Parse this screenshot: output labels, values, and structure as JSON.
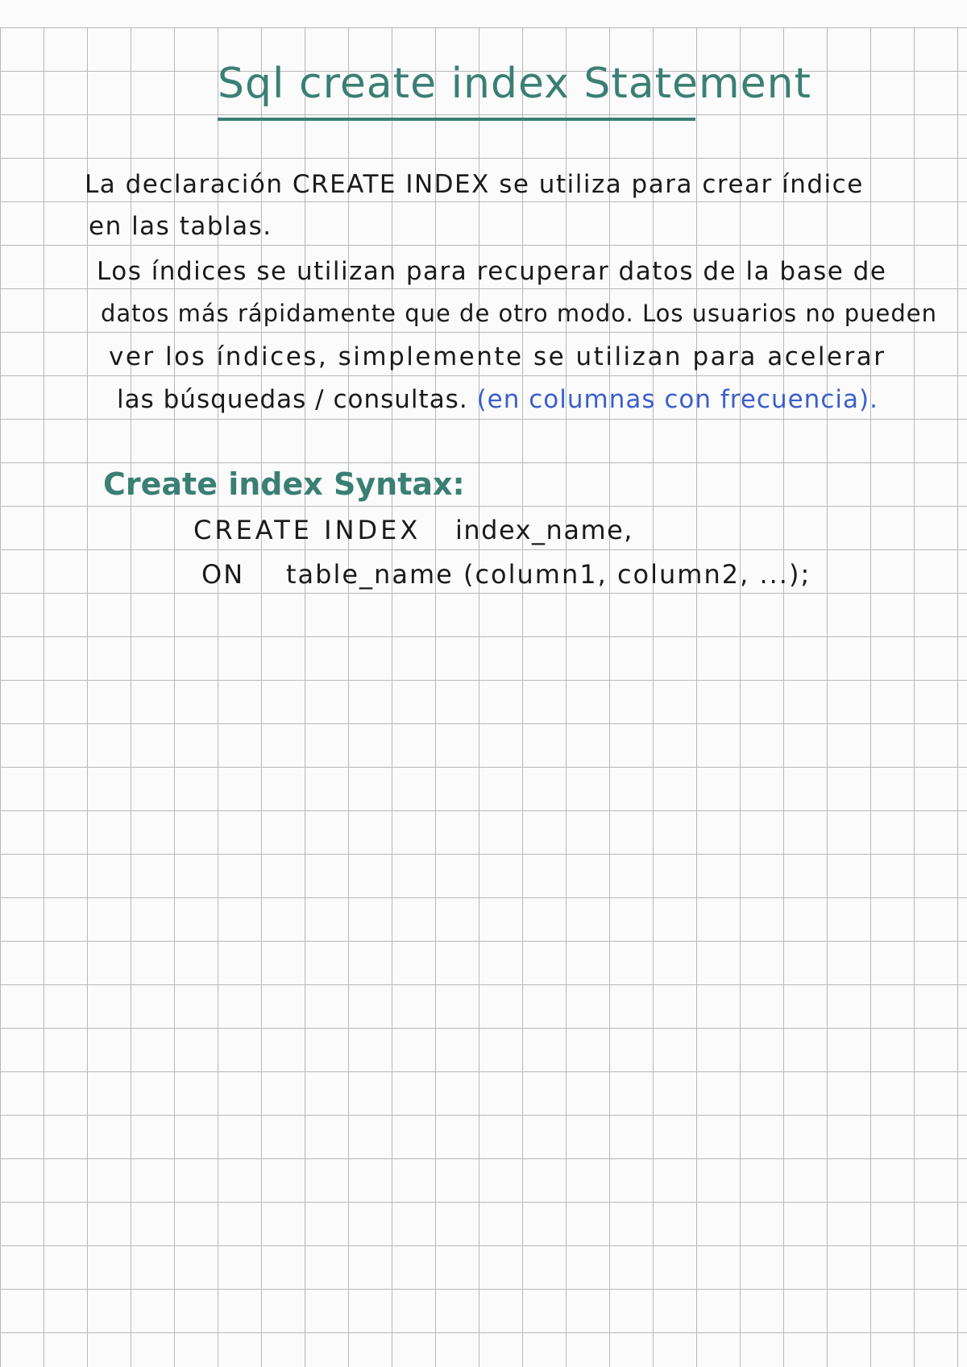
{
  "title": "Sql create index Statement",
  "paragraph1": {
    "line1": "La declaración CREATE INDEX se utiliza para crear índice",
    "line2": "en las tablas."
  },
  "paragraph2": {
    "line1": "Los índices se utilizan para recuperar datos de la base de",
    "line2": "datos más rápidamente que de otro modo. Los usuarios no pueden",
    "line3": "ver los índices, simplemente se utilizan para acelerar",
    "line4_black": "las búsquedas / consultas.",
    "line4_blue": "(en columnas con frecuencia)."
  },
  "syntax": {
    "heading": "Create index Syntax:",
    "kw_create_index": "CREATE INDEX",
    "index_name": "index_name,",
    "kw_on": "ON",
    "table_columns": "table_name (column1, column2, ...);"
  },
  "colors": {
    "accent_green": "#3a7f74",
    "ink_blue": "#3a5fcc",
    "ink_black": "#1a1a1a",
    "grid": "#b8b8b8"
  }
}
